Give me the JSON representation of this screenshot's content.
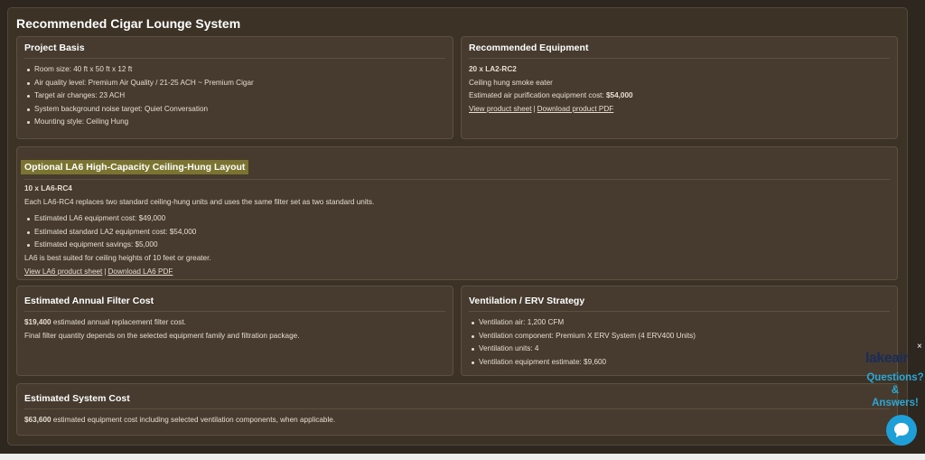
{
  "page": {
    "title": "Recommended Cigar Lounge System"
  },
  "project_basis": {
    "title": "Project Basis",
    "items": [
      "Room size: 40 ft x 50 ft x 12 ft",
      "Air quality level: Premium Air Quality / 21-25 ACH ~ Premium Cigar",
      "Target air changes: 23 ACH",
      "System background noise target: Quiet Conversation",
      "Mounting style: Ceiling Hung"
    ]
  },
  "recommended_equipment": {
    "title": "Recommended Equipment",
    "model": "20 x LA2-RC2",
    "description": "Ceiling hung smoke eater",
    "cost_label": "Estimated air purification equipment cost: ",
    "cost_value": "$54,000",
    "link_sheet": "View product sheet",
    "link_sep": "|",
    "link_pdf": "Download product PDF"
  },
  "la6_layout": {
    "title": "Optional LA6 High-Capacity Ceiling-Hung Layout",
    "model": "10 x LA6-RC4",
    "description": "Each LA6-RC4 replaces two standard ceiling-hung units and uses the same filter set as two standard units.",
    "items": [
      "Estimated LA6 equipment cost: $49,000",
      "Estimated standard LA2 equipment cost: $54,000",
      "Estimated equipment savings: $5,000"
    ],
    "note": "LA6 is best suited for ceiling heights of 10 feet or greater.",
    "link_sheet": "View LA6 product sheet",
    "link_sep": "|",
    "link_pdf": "Download LA6 PDF"
  },
  "filter_cost": {
    "title": "Estimated Annual Filter Cost",
    "value": "$19,400",
    "value_suffix": " estimated annual replacement filter cost.",
    "note": "Final filter quantity depends on the selected equipment family and filtration package."
  },
  "ventilation": {
    "title": "Ventilation / ERV Strategy",
    "items": [
      "Ventilation air: 1,200 CFM",
      "Ventilation component: Premium X ERV System (4 ERV400 Units)",
      "Ventilation units: 4",
      "Ventilation equipment estimate: $9,600"
    ]
  },
  "system_cost": {
    "title": "Estimated System Cost",
    "value": "$63,600",
    "value_suffix": " estimated equipment cost including selected ventilation components, when applicable."
  },
  "chat_widget": {
    "logo_text": "lakeair",
    "close_glyph": "×",
    "line1": "Questions?",
    "line2": "&",
    "line3": "Answers!",
    "icon": "chat-bubble-icon",
    "accent_color": "#1e9fd8"
  }
}
